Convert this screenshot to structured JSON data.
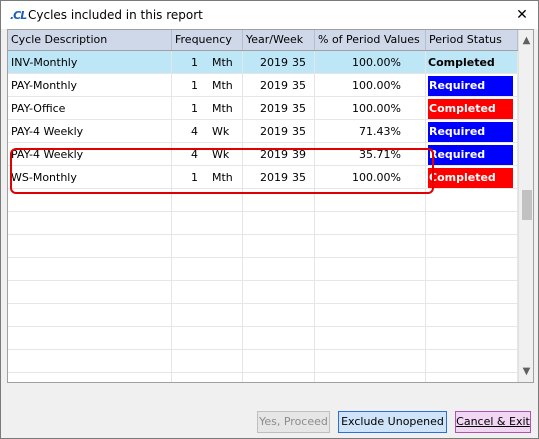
{
  "window": {
    "logo": ".CL",
    "title": "Cycles included in this report",
    "close_glyph": "✕"
  },
  "table": {
    "headers": [
      "Cycle Description",
      "Frequency",
      "Year/Week",
      "% of Period Values",
      "Period Status"
    ],
    "rows": [
      {
        "desc": "INV-Monthly",
        "freq_num": "1",
        "freq_unit": "Mth",
        "year": "2019",
        "week": "35",
        "pct": "100.00%",
        "status": "Completed",
        "status_style": "plain"
      },
      {
        "desc": "PAY-Monthly",
        "freq_num": "1",
        "freq_unit": "Mth",
        "year": "2019",
        "week": "35",
        "pct": "100.00%",
        "status": "Required",
        "status_style": "blue"
      },
      {
        "desc": "PAY-Office",
        "freq_num": "1",
        "freq_unit": "Mth",
        "year": "2019",
        "week": "35",
        "pct": "100.00%",
        "status": "Completed",
        "status_style": "red"
      },
      {
        "desc": "PAY-4 Weekly",
        "freq_num": "4",
        "freq_unit": "Wk",
        "year": "2019",
        "week": "35",
        "pct": "71.43%",
        "status": "Required",
        "status_style": "blue"
      },
      {
        "desc": "PAY-4 Weekly",
        "freq_num": "4",
        "freq_unit": "Wk",
        "year": "2019",
        "week": "39",
        "pct": "35.71%",
        "status": "Required",
        "status_style": "blue"
      },
      {
        "desc": "WS-Monthly",
        "freq_num": "1",
        "freq_unit": "Mth",
        "year": "2019",
        "week": "35",
        "pct": "100.00%",
        "status": "Completed",
        "status_style": "red"
      }
    ],
    "empty_rows": 9
  },
  "scrollbar": {
    "up_glyph": "▲",
    "down_glyph": "▼"
  },
  "buttons": {
    "proceed": "Yes, Proceed",
    "exclude": "Exclude Unopened",
    "cancel": "Cancel & Exit"
  },
  "colors": {
    "selected_row": "#bde6f6",
    "required_bg": "#0000ff",
    "completed_bg": "#ff0000",
    "highlight_outline": "#e00000"
  }
}
